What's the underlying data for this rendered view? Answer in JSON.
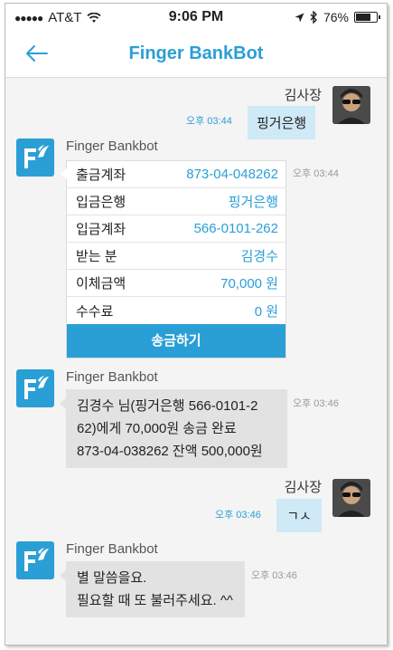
{
  "status_bar": {
    "carrier": "AT&T",
    "time": "9:06 PM",
    "battery": "76%",
    "battery_level": 0.76
  },
  "header": {
    "title": "Finger BankBot"
  },
  "messages": {
    "m1": {
      "sender": "김사장",
      "time": "오후 03:44",
      "text": "핑거은행"
    },
    "m2": {
      "sender": "Finger Bankbot",
      "time": "오후 03:44",
      "rows": [
        {
          "key": "출금계좌",
          "value": "873-04-048262"
        },
        {
          "key": "입금은행",
          "value": "핑거은행"
        },
        {
          "key": "입금계좌",
          "value": "566-0101-262"
        },
        {
          "key": "받는 분",
          "value": "김경수"
        },
        {
          "key": "이체금액",
          "value": "70,000 원"
        },
        {
          "key": "수수료",
          "value": "0 원"
        }
      ],
      "button": "송금하기"
    },
    "m3": {
      "sender": "Finger Bankbot",
      "time": "오후 03:46",
      "lines": [
        "김경수 님(핑거은행 566-0101-2",
        "62)에게 70,000원 송금 완료",
        "873-04-038262 잔액 500,000원"
      ]
    },
    "m4": {
      "sender": "김사장",
      "time": "오후 03:46",
      "text": "ㄱㅅ"
    },
    "m5": {
      "sender": "Finger Bankbot",
      "time": "오후 03:46",
      "lines": [
        "별 말씀을요.",
        "필요할 때 또 불러주세요. ^^"
      ]
    }
  }
}
